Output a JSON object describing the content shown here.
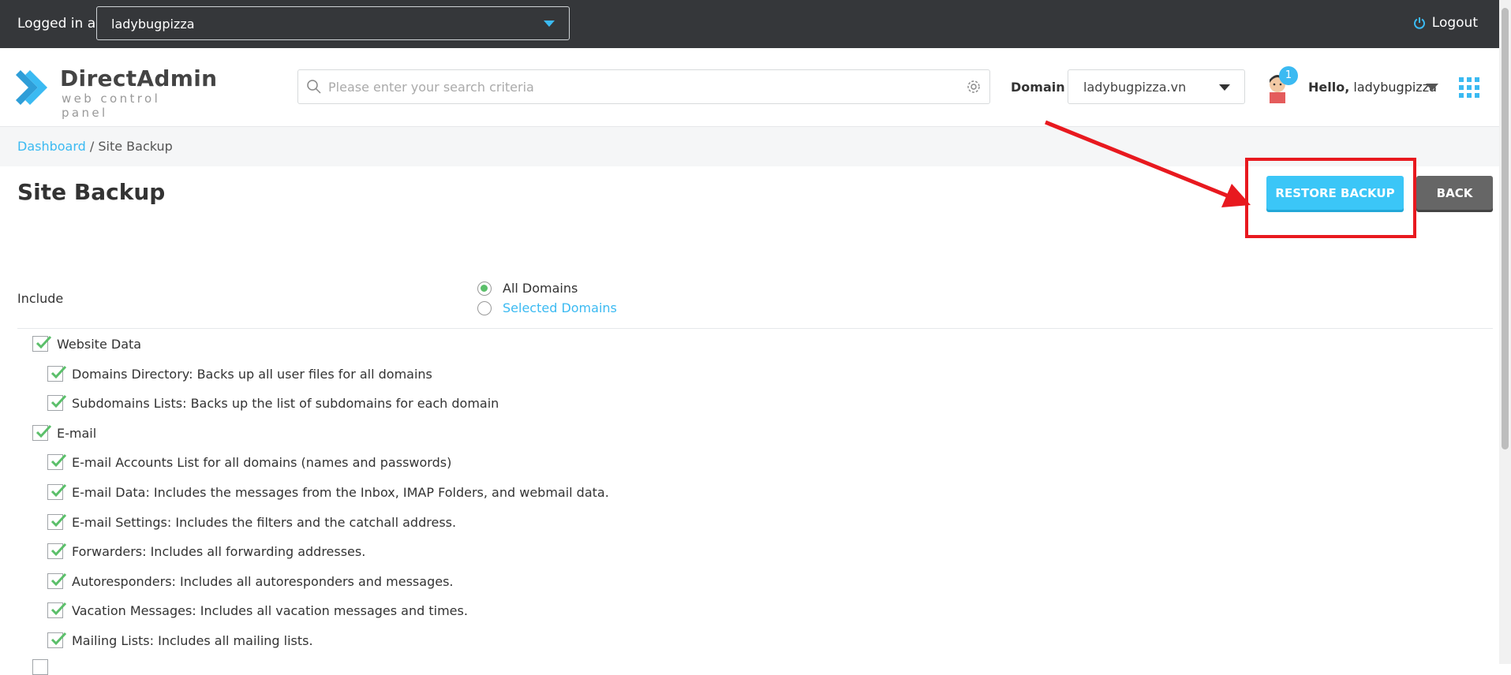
{
  "topbar": {
    "logged_in_as": "Logged in as",
    "user_value": "ladybugpizza",
    "logout": "Logout"
  },
  "header": {
    "logo_name": "DirectAdmin",
    "logo_sub": "web control panel",
    "search_placeholder": "Please enter your search criteria",
    "domain_label": "Domain",
    "domain_value": "ladybugpizza.vn",
    "notification_count": "1",
    "hello": "Hello,",
    "username": "ladybugpizza"
  },
  "breadcrumb": {
    "dashboard": "Dashboard",
    "separator": " / ",
    "current": "Site Backup"
  },
  "page": {
    "title": "Site Backup",
    "restore_button": "RESTORE BACKUP",
    "back_button": "BACK"
  },
  "include": {
    "label": "Include",
    "options": [
      "All Domains",
      "Selected Domains"
    ],
    "selected": "All Domains"
  },
  "groups": [
    {
      "label": "Website Data",
      "checked": true,
      "items": [
        "Domains Directory: Backs up all user files for all domains",
        "Subdomains Lists: Backs up the list of subdomains for each domain"
      ]
    },
    {
      "label": "E-mail",
      "checked": true,
      "items": [
        "E-mail Accounts List for all domains (names and passwords)",
        "E-mail Data: Includes the messages from the Inbox, IMAP Folders, and webmail data.",
        "E-mail Settings: Includes the filters and the catchall address.",
        "Forwarders: Includes all forwarding addresses.",
        "Autoresponders: Includes all autoresponders and messages.",
        "Vacation Messages: Includes all vacation messages and times.",
        "Mailing Lists: Includes all mailing lists."
      ]
    }
  ],
  "colors": {
    "accent": "#3bbaf2",
    "topbar": "#35373a",
    "check": "#5bbf6a",
    "annotation": "#e8191f"
  }
}
